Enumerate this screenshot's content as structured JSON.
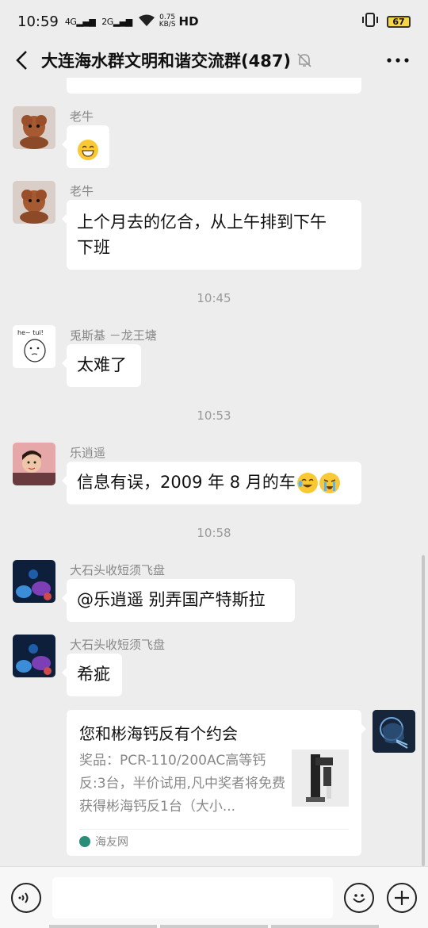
{
  "status_bar": {
    "time": "10:59",
    "signal_1": "4G",
    "signal_2": "2G",
    "net_speed_top": "0.75",
    "net_speed_bottom": "KB/S",
    "hd": "HD",
    "battery": "67"
  },
  "header": {
    "title": "大连海水群文明和谐交流群(487)"
  },
  "messages": [
    {
      "sender": "老牛",
      "type": "emoji"
    },
    {
      "sender": "老牛",
      "text_line1": "上个月去的亿合，从上午排到下午",
      "text_line2": "下班"
    },
    {
      "timestamp": "10:45"
    },
    {
      "sender": "兎斯基 －龙王塘",
      "text": "太难了"
    },
    {
      "timestamp": "10:53"
    },
    {
      "sender": "乐逍遥",
      "text": "信息有误，2009 年 8 月的车"
    },
    {
      "timestamp": "10:58"
    },
    {
      "sender": "大石头收短须飞盘",
      "text": "@乐逍遥  别弄国产特斯拉"
    },
    {
      "sender": "大石头收短须飞盘",
      "text": "希疵"
    }
  ],
  "card": {
    "title": "您和彬海钙反有个约会",
    "desc": "奖品：PCR-110/200AC高等钙反:3台，半价试用,凡中奖者将免费获得彬海钙反1台（大小...",
    "source": "海友网"
  },
  "colors": {
    "background": "#ededed",
    "bubble": "#ffffff",
    "meta_text": "#888888"
  }
}
